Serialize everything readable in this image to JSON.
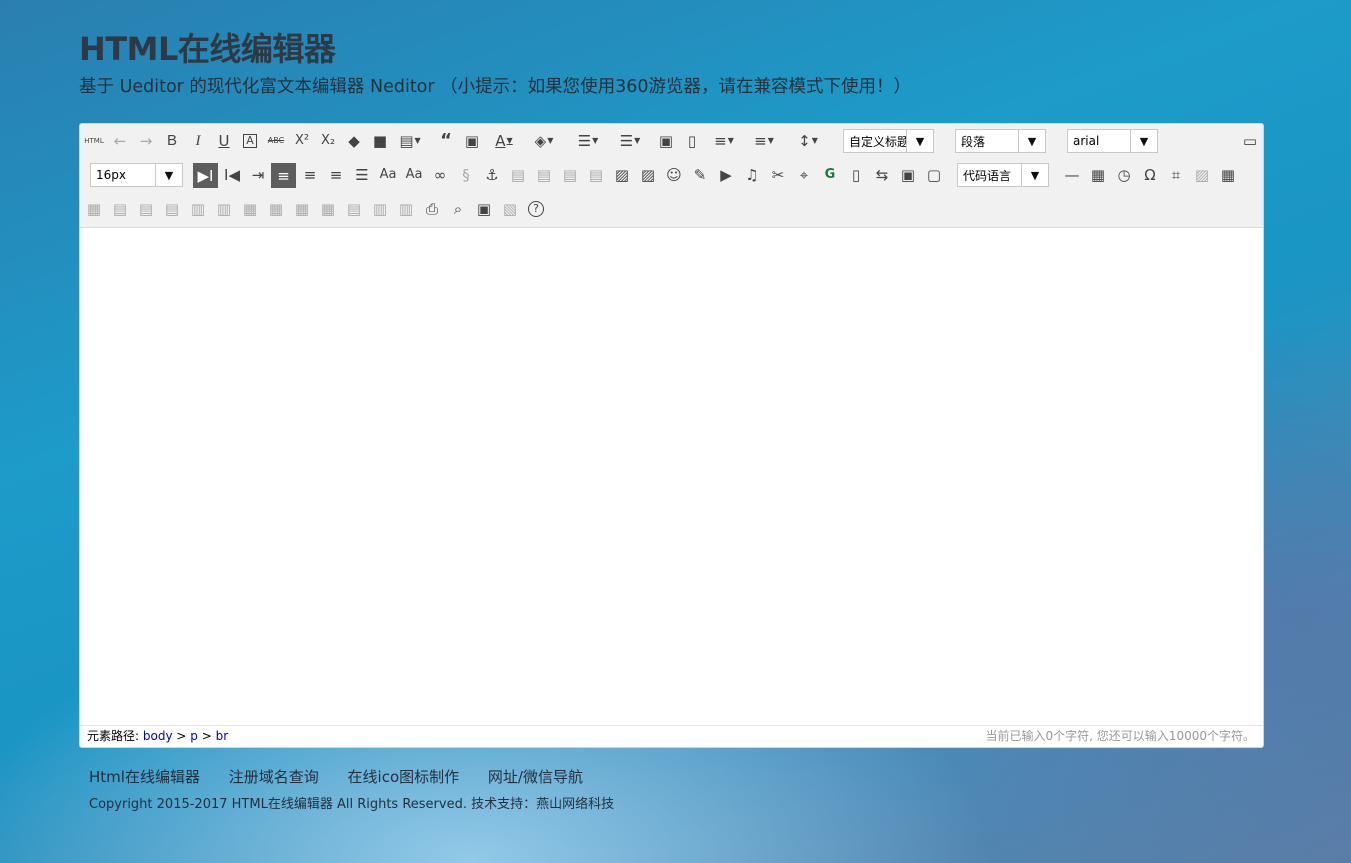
{
  "page": {
    "title": "HTML在线编辑器",
    "subtitle": "基于 Ueditor 的现代化富文本编辑器 Neditor （小提示：如果您使用360游览器，请在兼容模式下使用！）"
  },
  "toolbar": {
    "custom_heading": "自定义标题",
    "paragraph": "段落",
    "font_family": "arial",
    "font_size": "16px",
    "code_language": "代码语言",
    "html_button": "HTML"
  },
  "statusbar": {
    "path_label": "元素路径:",
    "path_body": "body",
    "path_p": "p",
    "path_br": "br",
    "sep": ">",
    "word_count": "当前已输入0个字符, 您还可以输入10000个字符。"
  },
  "footer": {
    "links": [
      "Html在线编辑器",
      "注册域名查询",
      "在线ico图标制作",
      "网址/微信导航"
    ],
    "copyright": "Copyright 2015-2017 HTML在线编辑器 All Rights Reserved. 技术支持：燕山网络科技"
  }
}
